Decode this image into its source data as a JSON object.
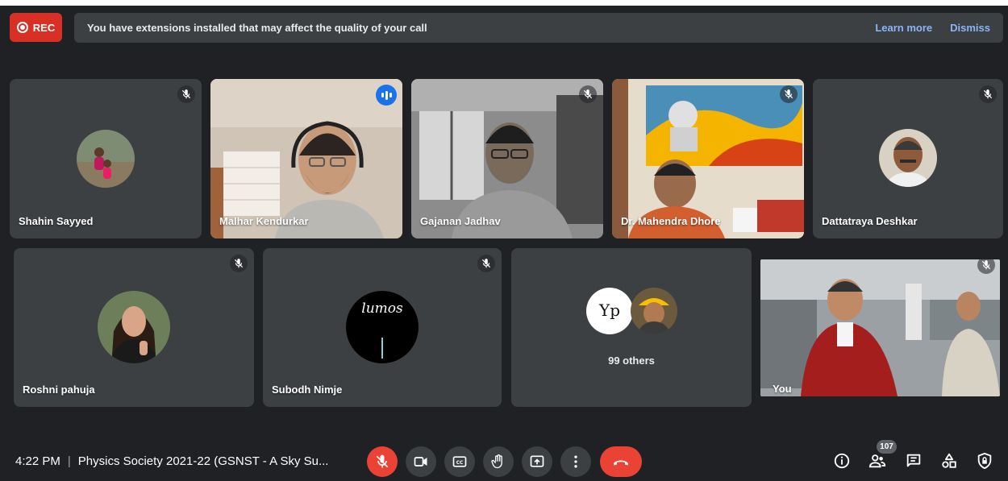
{
  "recording": {
    "label": "REC"
  },
  "banner": {
    "message": "You have extensions installed that may affect the quality of your call",
    "learn_more": "Learn more",
    "dismiss": "Dismiss"
  },
  "participants": [
    {
      "name": "Shahin Sayyed",
      "muted": true,
      "video": false
    },
    {
      "name": "Malhar Kendurkar",
      "muted": false,
      "video": true,
      "speaking": true
    },
    {
      "name": "Gajanan Jadhav",
      "muted": true,
      "video": true
    },
    {
      "name": "Dr. Mahendra Dhore",
      "muted": true,
      "video": true
    },
    {
      "name": "Dattatraya Deshkar",
      "muted": true,
      "video": false
    },
    {
      "name": "Roshni pahuja",
      "muted": true,
      "video": false
    },
    {
      "name": "Subodh Nimje",
      "muted": true,
      "video": false,
      "avatar_text": "lumos"
    },
    {
      "name": "99 others",
      "group": true,
      "avatar_text": "Yp"
    },
    {
      "name": "You",
      "muted": true,
      "video": true
    }
  ],
  "meeting": {
    "time": "4:22 PM",
    "title": "Physics Society 2021-22 (GSNST - A Sky Su..."
  },
  "controls": {
    "participant_count": "107",
    "icons": [
      "mic-off-icon",
      "camera-icon",
      "captions-icon",
      "raise-hand-icon",
      "present-icon",
      "more-options-icon",
      "hang-up-icon"
    ],
    "right_icons": [
      "info-icon",
      "people-icon",
      "chat-icon",
      "activities-icon",
      "host-controls-icon"
    ]
  },
  "colors": {
    "background": "#202124",
    "tile": "#3c4043",
    "accent": "#8ab4f8",
    "danger": "#ea4335"
  }
}
